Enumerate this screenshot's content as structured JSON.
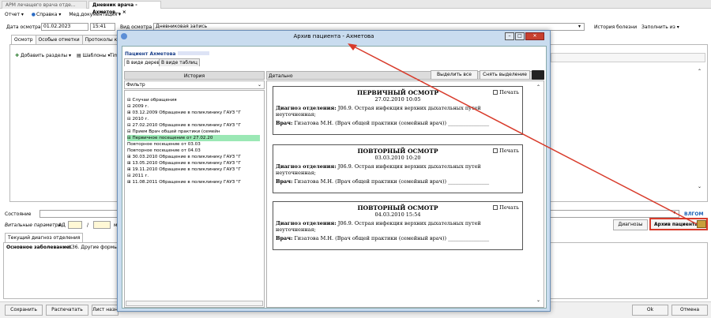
{
  "tabs": [
    {
      "label": "АРМ лечащего врача отде..."
    },
    {
      "label": "Дневник врача - Ахметов... ×"
    }
  ],
  "menu": [
    "Отчет ▾",
    "Справка ▾",
    "Мед.документация ▾"
  ],
  "datebar": {
    "date_label": "Дата осмотра",
    "date_value": "01.02.2023",
    "time_value": "15:41",
    "kind_label": "Вид осмотра",
    "kind_value": "Дневниковая запись",
    "history_btn": "История болезни",
    "fill_btn": "Заполнить из ▾"
  },
  "subtabs": [
    "Осмотр",
    "Особые отметки",
    "Протоколы консул"
  ],
  "toolbar": {
    "add_sections": "Добавить разделы ▾",
    "templates": "Шаблоны ▾",
    "tim": "Tim"
  },
  "lower": {
    "state_label": "Состояние",
    "vitals_label": "Витальные параметры",
    "ad_label": "АД",
    "slash": "/",
    "mm": "мм",
    "current_diag_tab": "Текущий диагноз отделения",
    "main_disease_label": "Основное заболевание:",
    "main_disease_value": "K36. Другие формы апп",
    "diagnoses_btn": "Диагнозы",
    "archive_btn": "Архив пациента",
    "chevron": "▾",
    "wpom": "ВЛГОМ"
  },
  "footer": {
    "save": "Сохранить",
    "print": "Распечатать",
    "sheet": "Лист назн",
    "ok": "Ok",
    "cancel": "Отмена"
  },
  "dialog": {
    "title": "Архив пациента - Ахметова",
    "patient_label": "Пациент",
    "patient_name": "Ахметова",
    "view_tree": "В виде дерева",
    "view_table": "В виде таблиц",
    "history_header": "История",
    "detail_header": "Детально",
    "select_all": "Выделить все",
    "deselect": "Снять выделение",
    "filter_label": "Фильтр",
    "tree": [
      "⊟ Случаи обращения",
      "   ⊟ 2009 г.",
      "      ⊞ 03.12.2009 Обращение в поликлинику ГАУЗ \"Г",
      "   ⊟ 2010 г.",
      "      ⊟ 27.02.2010 Обращение в поликлинику ГАУЗ \"Г",
      "         ⊟ Прием Врач общей практики (семейн",
      "            ⊟ Первичное посещение от 27.02.20",
      "                  Повторное посещение от 03.03",
      "                  Повторное посещение от 04.03",
      "      ⊞ 30.03.2010 Обращение в поликлинику ГАУЗ \"Г",
      "      ⊞ 13.05.2010 Обращение в поликлинику ГАУЗ \"Г",
      "      ⊞ 19.11.2010 Обращение в поликлинику ГАУЗ \"Г",
      "   ⊟ 2011 г.",
      "      ⊞ 11.08.2011 Обращение в поликлинику ГАУЗ \"Г"
    ],
    "print_label": "Печать",
    "cards": [
      {
        "title": "ПЕРВИЧНЫЙ ОСМОТР",
        "date": "27.02.2010 10:05",
        "diag_label": "Диагноз отделения:",
        "diag": " J06.9. Острая инфекция верхних дыхательных путей неуточненная;",
        "doc_label": "Врач:",
        "doc": " Гизатова М.Н. (Врач общей практики (семейный врач)) ________________"
      },
      {
        "title": "ПОВТОРНЫЙ ОСМОТР",
        "date": "03.03.2010 10:20",
        "diag_label": "Диагноз отделения:",
        "diag": " J06.9. Острая инфекция верхних дыхательных путей неуточненная;",
        "doc_label": "Врач:",
        "doc": " Гизатова М.Н. (Врач общей практики (семейный врач)) ________________"
      },
      {
        "title": "ПОВТОРНЫЙ ОСМОТР",
        "date": "04.03.2010 15:54",
        "diag_label": "Диагноз отделения:",
        "diag": " J06.9. Острая инфекция верхних дыхательных путей неуточненная;",
        "doc_label": "Врач:",
        "doc": " Гизатова М.Н. (Врач общей практики (семейный врач)) ________________"
      }
    ]
  },
  "colors": {
    "accent": "#d83b2b",
    "title_bar": "#c9dcef",
    "highlight": "#9be8b5"
  }
}
